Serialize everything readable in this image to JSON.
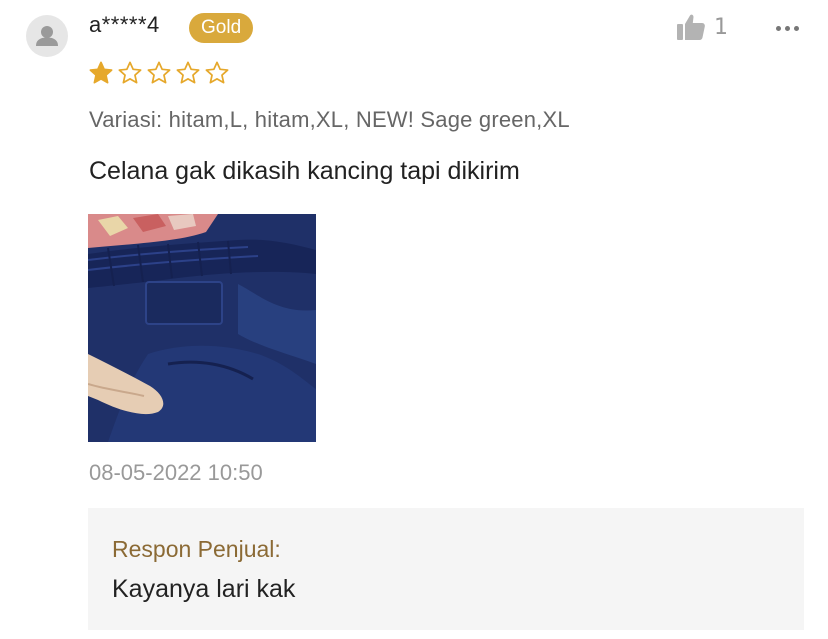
{
  "review": {
    "username": "a*****4",
    "badge": "Gold",
    "like_count": "1",
    "rating": 1,
    "rating_max": 5,
    "variation": "Variasi: hitam,L, hitam,XL, NEW! Sage green,XL",
    "text": "Celana gak dikasih kancing tapi dikirim",
    "timestamp": "08-05-2022 10:50"
  },
  "seller_response": {
    "label": "Respon Penjual:",
    "text": "Kayanya lari kak"
  },
  "colors": {
    "badge": "#d9a93c",
    "star": "#e6a82b",
    "seller_label": "#8b6a35",
    "muted": "#999999"
  },
  "icons": {
    "avatar": "user-avatar-icon",
    "like": "thumbs-up-icon",
    "more": "more-options-icon",
    "star": "star-icon"
  }
}
